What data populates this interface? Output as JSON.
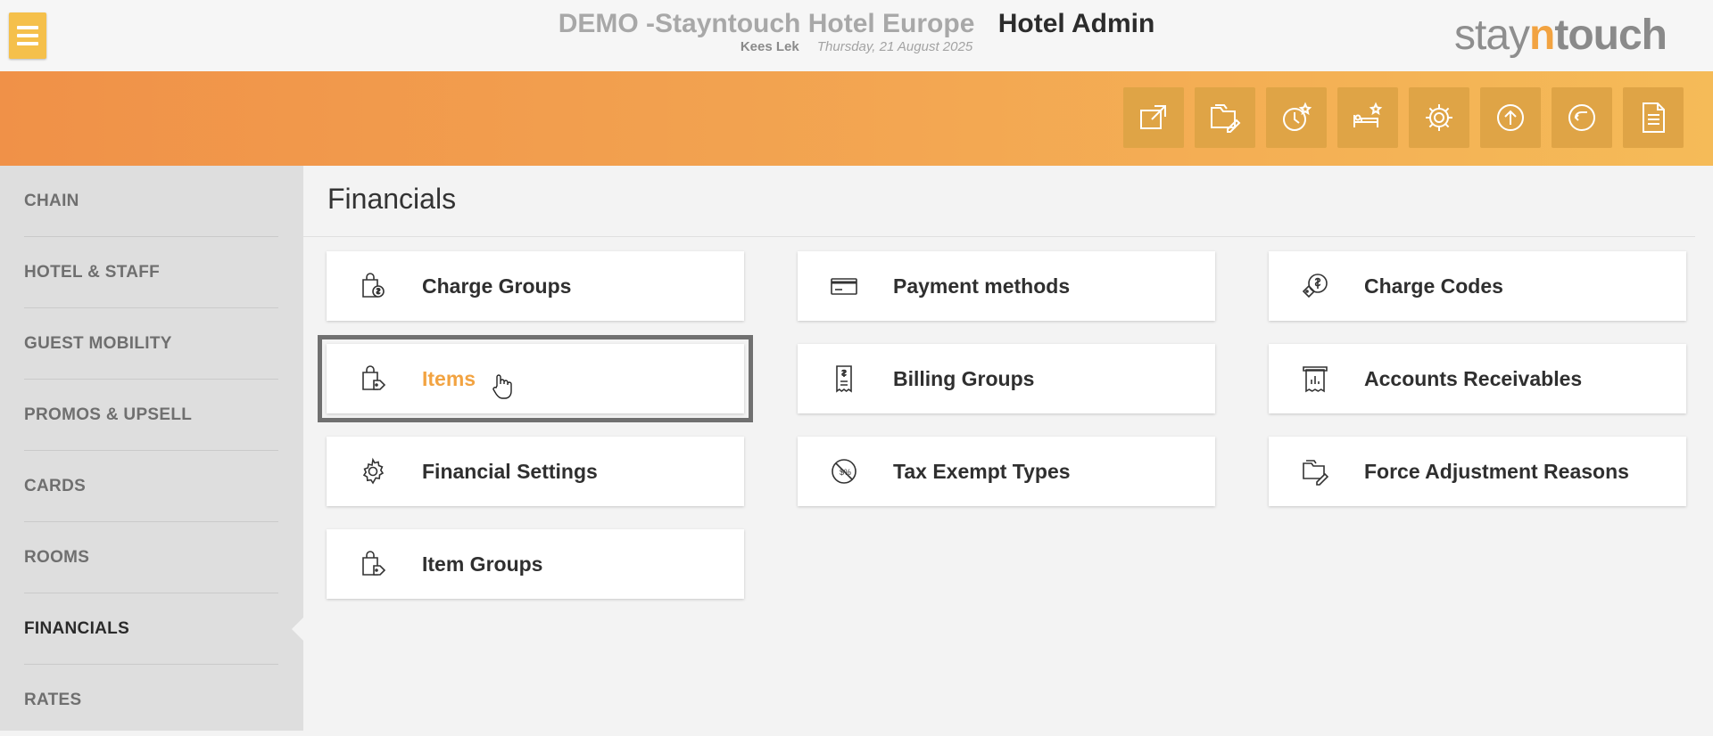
{
  "header": {
    "hotel_name": "DEMO -Stayntouch Hotel Europe",
    "section": "Hotel Admin",
    "user": "Kees Lek",
    "date": "Thursday, 21 August 2025",
    "logo": {
      "stay": "stay",
      "n": "n",
      "touch": "touch",
      "accent_color": "#f2a341"
    }
  },
  "quick_actions": [
    {
      "icon": "external-link-icon"
    },
    {
      "icon": "folder-edit-icon"
    },
    {
      "icon": "clock-star-icon"
    },
    {
      "icon": "bed-star-icon"
    },
    {
      "icon": "gear-icon"
    },
    {
      "icon": "upload-circle-icon"
    },
    {
      "icon": "rewind-circle-icon"
    },
    {
      "icon": "document-icon"
    }
  ],
  "sidebar": {
    "items": [
      {
        "label": "CHAIN"
      },
      {
        "label": "HOTEL & STAFF"
      },
      {
        "label": "GUEST MOBILITY"
      },
      {
        "label": "PROMOS & UPSELL"
      },
      {
        "label": "CARDS"
      },
      {
        "label": "ROOMS"
      },
      {
        "label": "FINANCIALS",
        "active": true
      },
      {
        "label": "RATES"
      }
    ]
  },
  "main": {
    "title": "Financials",
    "tiles": [
      {
        "label": "Charge Groups",
        "icon": "shopping-bag-dollar-icon"
      },
      {
        "label": "Payment methods",
        "icon": "credit-card-icon"
      },
      {
        "label": "Charge Codes",
        "icon": "dollar-tag-icon"
      },
      {
        "label": "Items",
        "icon": "shopping-bag-tag-icon",
        "selected": true
      },
      {
        "label": "Billing Groups",
        "icon": "receipt-dollar-icon"
      },
      {
        "label": "Accounts Receivables",
        "icon": "receipt-chart-icon"
      },
      {
        "label": "Financial Settings",
        "icon": "gear-icon"
      },
      {
        "label": "Tax Exempt Types",
        "icon": "no-tax-icon"
      },
      {
        "label": "Force Adjustment Reasons",
        "icon": "folder-edit-icon"
      },
      {
        "label": "Item Groups",
        "icon": "shopping-bag-tag-icon"
      }
    ]
  },
  "colors": {
    "accent": "#f2a341",
    "band_start": "#f09148",
    "band_end": "#f5bb58",
    "menu_button": "#f5c04b"
  }
}
